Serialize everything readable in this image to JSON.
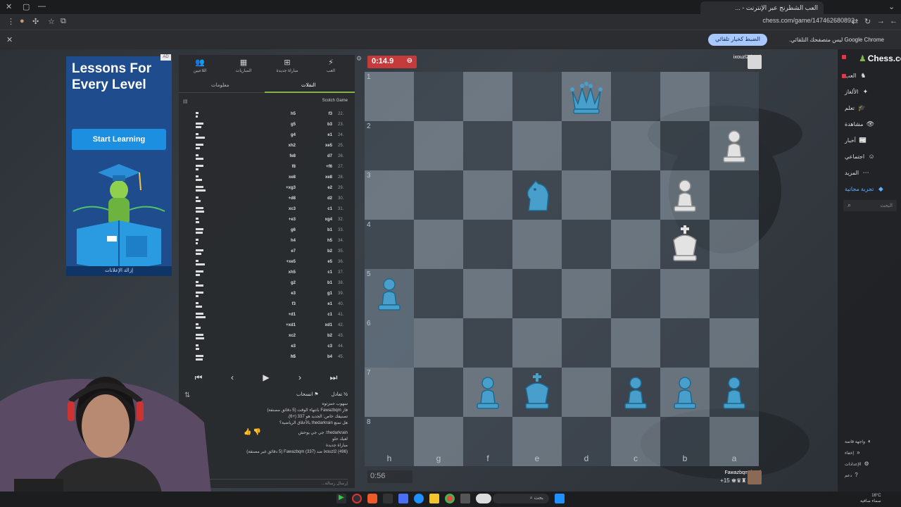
{
  "browser": {
    "tab_title": "العب الشطرنج عبر الإنترنت - ...",
    "url": "chess.com/game/147462680892",
    "info_message": "Google Chrome ليس متصفحك التلقائي.",
    "info_button": "الضبط كخيار تلقائي"
  },
  "ad": {
    "title": "Lessons For Every Level",
    "button": "Start Learning",
    "remove": "إزالة الإعلانات",
    "badge": "AD"
  },
  "panel": {
    "tabs": [
      "العب",
      "مباراة جديدة",
      "المباريات",
      "اللاعبين"
    ],
    "subtabs": [
      "النقلات",
      "معلومات"
    ],
    "opening": "Scotch Game",
    "moves": [
      {
        "n": "22.",
        "w": "f3",
        "b": "h5"
      },
      {
        "n": "23.",
        "w": "b3",
        "b": "g5"
      },
      {
        "n": "24.",
        "w": "e1",
        "b": "g4"
      },
      {
        "n": "25.",
        "w": "xe5",
        "b": "xh2"
      },
      {
        "n": "26.",
        "w": "d7",
        "b": "fe8"
      },
      {
        "n": "27.",
        "w": "+f6",
        "b": "f8"
      },
      {
        "n": "28.",
        "w": "xe8",
        "b": "xe8"
      },
      {
        "n": "29.",
        "w": "e2",
        "b": "+xg3"
      },
      {
        "n": "30.",
        "w": "d2",
        "b": "+d8"
      },
      {
        "n": "31.",
        "w": "c1",
        "b": "xc3"
      },
      {
        "n": "32.",
        "w": "xg4",
        "b": "+e3"
      },
      {
        "n": "33.",
        "w": "b1",
        "b": "g6"
      },
      {
        "n": "34.",
        "w": "h5",
        "b": "h4"
      },
      {
        "n": "35.",
        "w": "b2",
        "b": "e7"
      },
      {
        "n": "36.",
        "w": "e5",
        "b": "+xe5"
      },
      {
        "n": "37.",
        "w": "c1",
        "b": "xh5"
      },
      {
        "n": "38.",
        "w": "b1",
        "b": "g2"
      },
      {
        "n": "39.",
        "w": "g1",
        "b": "e3"
      },
      {
        "n": "40.",
        "w": "e1",
        "b": "f3"
      },
      {
        "n": "41.",
        "w": "c1",
        "b": "+d1"
      },
      {
        "n": "42.",
        "w": "xd1",
        "b": "+xd1"
      },
      {
        "n": "43.",
        "w": "b2",
        "b": "xc2"
      },
      {
        "n": "44.",
        "w": "c3",
        "b": "e3"
      },
      {
        "n": "45.",
        "w": "b4",
        "b": "h5"
      }
    ],
    "actions": [
      "تعادل",
      "انسحاب"
    ],
    "chat": [
      "سهوب حمزتوه",
      "فاز Fawazbqm بانتهاء الوقت (5 دقائق مصنفة)",
      "تصنيفك خاص: الجديد هو 337 (+6).",
      "هل تمتع thedarkrain بالأخلاق الرياضية؟",
      "thedarkrain: جي جي يوحش",
      "لعبك حلو",
      "مباراة جديدة",
      "ixouzl2 (496) ضد Fawazbqm (337) (5 دقائق غير مصنفة)"
    ],
    "chat_placeholder": "إرسال رسالة..."
  },
  "game": {
    "top_clock": "0:14.9",
    "top_player": "ixouzl2 (496)",
    "bottom_clock": "0:56",
    "bottom_player": "Fawazbqm (337)",
    "bottom_material": "+15",
    "files": [
      "h",
      "g",
      "f",
      "e",
      "d",
      "c",
      "b",
      "a"
    ],
    "ranks": [
      "1",
      "2",
      "3",
      "4",
      "5",
      "6",
      "7",
      "8"
    ]
  },
  "sidebar": {
    "logo": "Chess.com",
    "items": [
      {
        "label": "العب",
        "icon": "♞"
      },
      {
        "label": "الألغاز",
        "icon": "✦"
      },
      {
        "label": "تعلم",
        "icon": "🎓"
      },
      {
        "label": "مشاهدة",
        "icon": "👁"
      },
      {
        "label": "أخبار",
        "icon": "📰"
      },
      {
        "label": "اجتماعي",
        "icon": "☺"
      },
      {
        "label": "المزيد",
        "icon": "⋯"
      },
      {
        "label": "تجربة مجانية",
        "icon": "◆"
      }
    ],
    "search_placeholder": "البحث",
    "footer": [
      {
        "label": "واجهة قاتمة",
        "icon": "◐"
      },
      {
        "label": "إخفاء",
        "icon": "«"
      },
      {
        "label": "الإعدادات",
        "icon": "⚙"
      },
      {
        "label": "دعم",
        "icon": "?"
      }
    ]
  },
  "taskbar": {
    "search": "بحث",
    "weather_temp": "16°C",
    "weather_desc": "سماء صافية"
  }
}
